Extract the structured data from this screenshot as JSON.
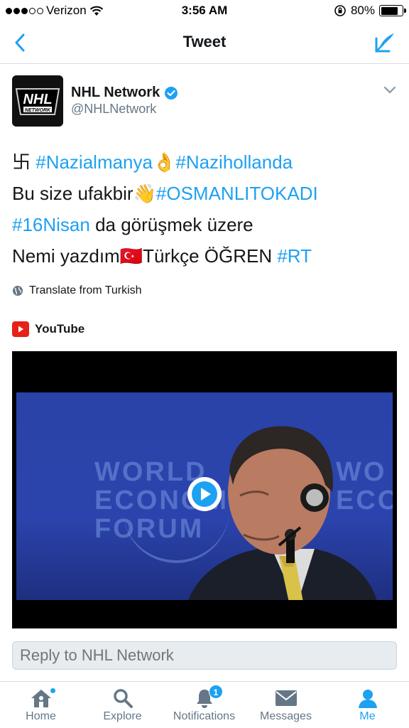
{
  "status_bar": {
    "carrier": "Verizon",
    "time": "3:56 AM",
    "battery": "80%",
    "battery_level": 0.8
  },
  "nav": {
    "title": "Tweet"
  },
  "tweet": {
    "user_name": "NHL Network",
    "handle": "@NHLNetwork",
    "avatar_text": "NHL",
    "avatar_subtext": "NETWORK",
    "lines": [
      {
        "parts": [
          {
            "t": "卐 ",
            "h": false
          },
          {
            "t": "#Nazialmanya",
            "h": true
          },
          {
            "t": "👌",
            "h": false
          },
          {
            "t": "#Nazihollanda",
            "h": true
          }
        ]
      },
      {
        "parts": [
          {
            "t": "Bu size ufakbir",
            "h": false
          },
          {
            "t": "👋",
            "h": false
          },
          {
            "t": "#OSMANLITOKADI",
            "h": true
          }
        ]
      },
      {
        "parts": [
          {
            "t": "#16Nisan",
            "h": true
          },
          {
            "t": " da görüşmek üzere",
            "h": false
          }
        ]
      },
      {
        "parts": [
          {
            "t": "Nemi yazdım",
            "h": false
          },
          {
            "t": "🇹🇷",
            "h": false
          },
          {
            "t": "Türkçe ÖĞREN ",
            "h": false
          },
          {
            "t": "#RT",
            "h": true
          }
        ]
      }
    ],
    "translate_label": "Translate from Turkish",
    "media_source": "YouTube",
    "video_overlay_left": "WORLD\nECONOM\nFORUM",
    "video_overlay_right": "WO\nECON"
  },
  "reply": {
    "placeholder": "Reply to NHL Network"
  },
  "tabs": [
    {
      "label": "Home",
      "icon": "home-icon",
      "dot": true
    },
    {
      "label": "Explore",
      "icon": "search-icon"
    },
    {
      "label": "Notifications",
      "icon": "bell-icon",
      "badge": "1"
    },
    {
      "label": "Messages",
      "icon": "envelope-icon"
    },
    {
      "label": "Me",
      "icon": "person-icon",
      "active": true
    }
  ],
  "colors": {
    "accent": "#1da1f2",
    "youtube": "#e62117"
  }
}
